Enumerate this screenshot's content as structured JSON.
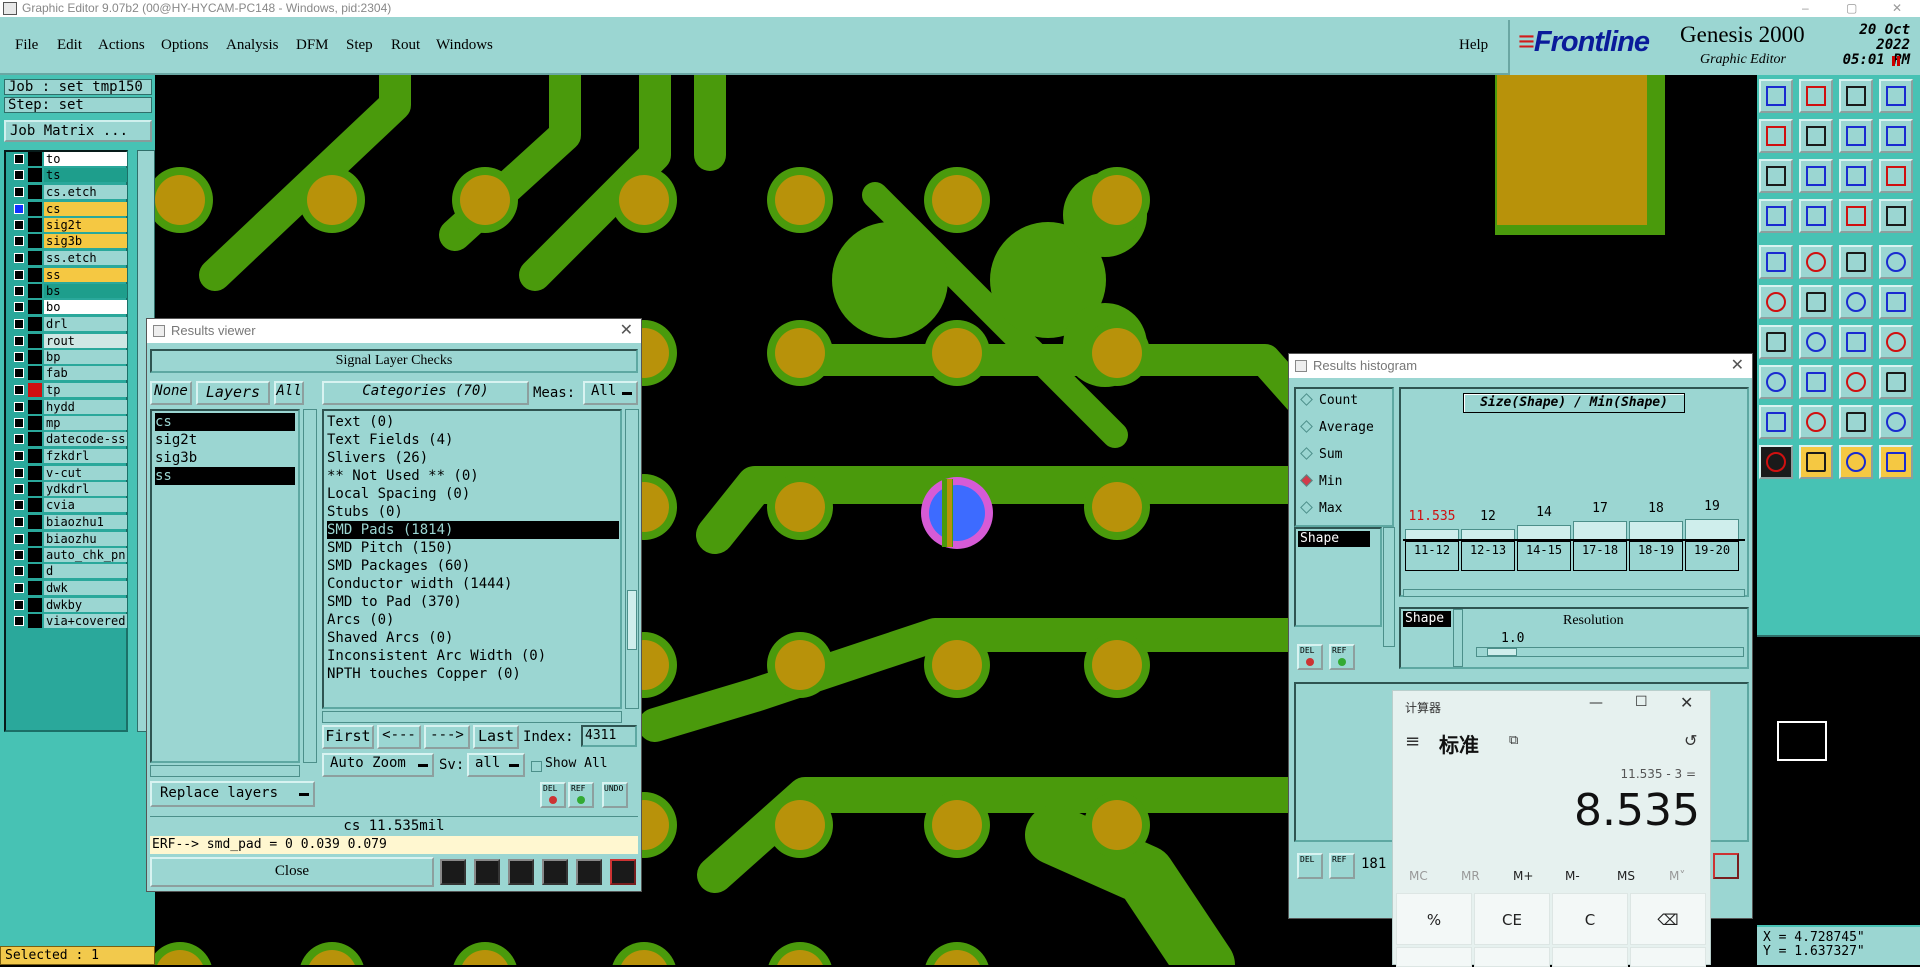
{
  "window": {
    "title": "Graphic Editor 9.07b2 (00@HY-HYCAM-PC148 - Windows, pid:2304)",
    "controls": [
      "–",
      "▢",
      "✕"
    ]
  },
  "menubar": {
    "items": [
      "File",
      "Edit",
      "Actions",
      "Options",
      "Analysis",
      "DFM",
      "Step",
      "Rout",
      "Windows"
    ],
    "help": "Help"
  },
  "brand": {
    "logo": "Frontline",
    "product": "Genesis 2000",
    "subtitle": "Graphic Editor",
    "date": "20 Oct 2022",
    "time": "05:01 PM"
  },
  "leftpanel": {
    "job": "Job : set_tmp150",
    "step": "Step: set",
    "job_matrix_label": "Job Matrix ...",
    "selected": "Selected : 1",
    "layers": [
      {
        "name": "to",
        "color": "#ffffff"
      },
      {
        "name": "ts",
        "color": "#1e9e8c"
      },
      {
        "name": "cs.etch",
        "color": "#9bd6d2"
      },
      {
        "name": "cs",
        "color": "#f5c842"
      },
      {
        "name": "sig2t",
        "color": "#f5c842"
      },
      {
        "name": "sig3b",
        "color": "#f5c842"
      },
      {
        "name": "ss.etch",
        "color": "#9bd6d2"
      },
      {
        "name": "ss",
        "color": "#f5c842"
      },
      {
        "name": "bs",
        "color": "#1e9e8c"
      },
      {
        "name": "bo",
        "color": "#ffffff"
      },
      {
        "name": "drl",
        "color": "#9bd6d2"
      },
      {
        "name": "rout",
        "color": "#cfe7e4"
      },
      {
        "name": "bp",
        "color": "#9bd6d2"
      },
      {
        "name": "fab",
        "color": "#9bd6d2"
      },
      {
        "name": "tp",
        "color": "#9bd6d2"
      },
      {
        "name": "hydd",
        "color": "#9bd6d2"
      },
      {
        "name": "mp",
        "color": "#9bd6d2"
      },
      {
        "name": "datecode-ss",
        "color": "#9bd6d2"
      },
      {
        "name": "fzkdrl",
        "color": "#9bd6d2"
      },
      {
        "name": "v-cut",
        "color": "#9bd6d2"
      },
      {
        "name": "ydkdrl",
        "color": "#9bd6d2"
      },
      {
        "name": "cvia",
        "color": "#9bd6d2"
      },
      {
        "name": "biaozhu1",
        "color": "#9bd6d2"
      },
      {
        "name": "biaozhu",
        "color": "#9bd6d2"
      },
      {
        "name": "auto_chk_pn",
        "color": "#9bd6d2"
      },
      {
        "name": "d",
        "color": "#9bd6d2"
      },
      {
        "name": "dwk",
        "color": "#9bd6d2"
      },
      {
        "name": "dwkby",
        "color": "#9bd6d2"
      },
      {
        "name": "via+covered",
        "color": "#9bd6d2"
      }
    ]
  },
  "results_viewer": {
    "title": "Results viewer",
    "heading": "Signal Layer Checks",
    "none_label": "None",
    "layers_label": "Layers",
    "all_label": "All",
    "categories_label": "Categories (70)",
    "meas_label": "Meas:",
    "meas_value": "All",
    "layer_items": [
      "cs",
      "sig2t",
      "sig3b",
      "ss"
    ],
    "categories": [
      "Text (0)",
      "Text Fields (4)",
      "Slivers (26)",
      "** Not Used ** (0)",
      "Local Spacing (0)",
      "Stubs (0)",
      "SMD Pads (1814)",
      "SMD Pitch (150)",
      "SMD Packages (60)",
      "Conductor width (1444)",
      "SMD to Pad (370)",
      "Arcs (0)",
      "Shaved Arcs (0)",
      "Inconsistent Arc Width (0)",
      "NPTH touches Copper (0)"
    ],
    "first_label": "First",
    "prev_label": "<---",
    "next_label": "--->",
    "last_label": "Last",
    "index_label": "Index:",
    "index_value": "4311",
    "auto_zoom_label": "Auto Zoom",
    "sv_label": "Sv:",
    "sv_value": "all",
    "show_all_label": "Show All",
    "replace_layers_label": "Replace layers",
    "del_label": "DEL",
    "ref_label": "REF",
    "undo_label": "UNDO",
    "status_line": "cs 11.535mil",
    "erf_line": "ERF--> smd_pad = 0 0.039 0.079",
    "close_label": "Close"
  },
  "histogram": {
    "title": "Results histogram",
    "options": [
      "Count",
      "Average",
      "Sum",
      "Min",
      "Max"
    ],
    "selected_option": "Min",
    "shape_label": "Shape",
    "chart_title": "Size(Shape) / Min(Shape)",
    "bar_values": [
      "11.535",
      "12",
      "14",
      "17",
      "18",
      "19"
    ],
    "bin_labels": [
      "11-12",
      "12-13",
      "14-15",
      "17-18",
      "18-19",
      "19-20"
    ],
    "resolution_label": "Resolution",
    "resolution_value": "1.0",
    "footer_value": "181",
    "del_label": "DEL",
    "ref_label": "REF"
  },
  "calculator": {
    "title": "计算器",
    "mode": "标准",
    "expression": "11.535 - 3 =",
    "display": "8.535",
    "memory_buttons": [
      "MC",
      "MR",
      "M+",
      "M-",
      "MS",
      "M˅"
    ],
    "row1": [
      "%",
      "CE",
      "C",
      "⌫"
    ]
  },
  "coords": {
    "x": "X = 4.728745\"",
    "y": "Y = 1.637327\""
  }
}
